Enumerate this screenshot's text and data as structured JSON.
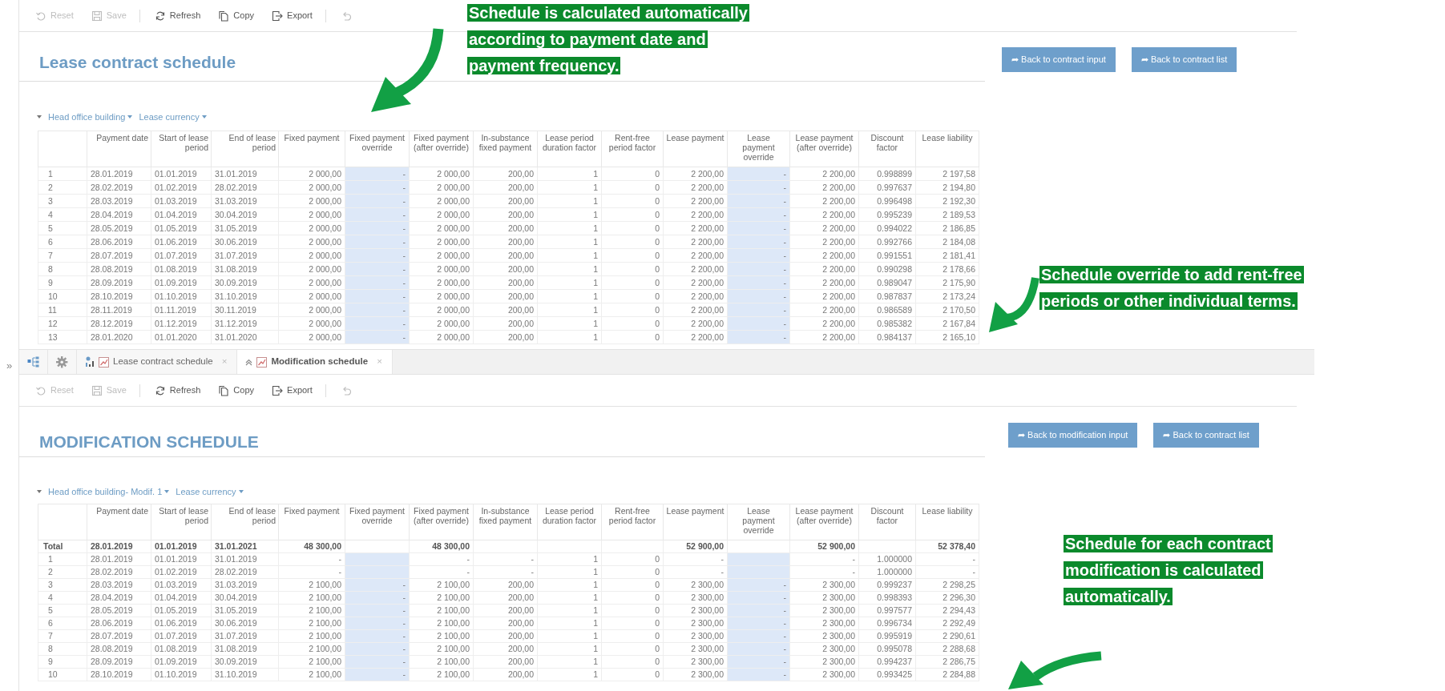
{
  "panes": [
    {
      "toolbar": {
        "groups": [
          [
            {
              "kind": "reset",
              "label": "Reset",
              "disabled": true
            },
            {
              "kind": "save",
              "label": "Save",
              "disabled": true
            }
          ],
          [
            {
              "kind": "refresh",
              "label": "Refresh",
              "disabled": false
            },
            {
              "kind": "copy",
              "label": "Copy",
              "disabled": false
            },
            {
              "kind": "export",
              "label": "Export",
              "disabled": false
            }
          ],
          [
            {
              "kind": "undo",
              "disabled": true
            }
          ]
        ]
      },
      "title": "Lease contract schedule",
      "buttons": [
        "➦ Back to contract input",
        "➦ Back to contract list"
      ],
      "filters": [
        {
          "label": "Head office building"
        },
        {
          "label": "Lease currency"
        }
      ],
      "table": {
        "columns": [
          {
            "kind": "index"
          },
          {
            "label": "Payment date",
            "kind": "date"
          },
          {
            "label": "Start of lease period",
            "kind": "date"
          },
          {
            "label": "End of lease period",
            "kind": "date"
          },
          {
            "label": "Fixed payment",
            "kind": "number"
          },
          {
            "label": "Fixed payment override",
            "kind": "override"
          },
          {
            "label": "Fixed payment (after override)",
            "kind": "number"
          },
          {
            "label": "In-substance fixed payment",
            "kind": "number"
          },
          {
            "label": "Lease period duration factor",
            "kind": "number"
          },
          {
            "label": "Rent-free period factor",
            "kind": "number"
          },
          {
            "label": "Lease payment",
            "kind": "number"
          },
          {
            "label": "Lease payment override",
            "kind": "override"
          },
          {
            "label": "Lease payment (after override)",
            "kind": "number"
          },
          {
            "label": "Discount factor",
            "kind": "number"
          },
          {
            "label": "Lease liability",
            "kind": "number"
          }
        ],
        "rows": [
          {
            "cells": [
              "1",
              "28.01.2019",
              "01.01.2019",
              "31.01.2019",
              "2 000,00",
              "-",
              "2 000,00",
              "200,00",
              "1",
              "0",
              "2 200,00",
              "-",
              "2 200,00",
              "0.998899",
              "2 197,58"
            ]
          },
          {
            "cells": [
              "2",
              "28.02.2019",
              "01.02.2019",
              "28.02.2019",
              "2 000,00",
              "-",
              "2 000,00",
              "200,00",
              "1",
              "0",
              "2 200,00",
              "-",
              "2 200,00",
              "0.997637",
              "2 194,80"
            ]
          },
          {
            "cells": [
              "3",
              "28.03.2019",
              "01.03.2019",
              "31.03.2019",
              "2 000,00",
              "-",
              "2 000,00",
              "200,00",
              "1",
              "0",
              "2 200,00",
              "-",
              "2 200,00",
              "0.996498",
              "2 192,30"
            ]
          },
          {
            "cells": [
              "4",
              "28.04.2019",
              "01.04.2019",
              "30.04.2019",
              "2 000,00",
              "-",
              "2 000,00",
              "200,00",
              "1",
              "0",
              "2 200,00",
              "-",
              "2 200,00",
              "0.995239",
              "2 189,53"
            ]
          },
          {
            "cells": [
              "5",
              "28.05.2019",
              "01.05.2019",
              "31.05.2019",
              "2 000,00",
              "-",
              "2 000,00",
              "200,00",
              "1",
              "0",
              "2 200,00",
              "-",
              "2 200,00",
              "0.994022",
              "2 186,85"
            ]
          },
          {
            "cells": [
              "6",
              "28.06.2019",
              "01.06.2019",
              "30.06.2019",
              "2 000,00",
              "-",
              "2 000,00",
              "200,00",
              "1",
              "0",
              "2 200,00",
              "-",
              "2 200,00",
              "0.992766",
              "2 184,08"
            ]
          },
          {
            "cells": [
              "7",
              "28.07.2019",
              "01.07.2019",
              "31.07.2019",
              "2 000,00",
              "-",
              "2 000,00",
              "200,00",
              "1",
              "0",
              "2 200,00",
              "-",
              "2 200,00",
              "0.991551",
              "2 181,41"
            ]
          },
          {
            "cells": [
              "8",
              "28.08.2019",
              "01.08.2019",
              "31.08.2019",
              "2 000,00",
              "-",
              "2 000,00",
              "200,00",
              "1",
              "0",
              "2 200,00",
              "-",
              "2 200,00",
              "0.990298",
              "2 178,66"
            ]
          },
          {
            "cells": [
              "9",
              "28.09.2019",
              "01.09.2019",
              "30.09.2019",
              "2 000,00",
              "-",
              "2 000,00",
              "200,00",
              "1",
              "0",
              "2 200,00",
              "-",
              "2 200,00",
              "0.989047",
              "2 175,90"
            ]
          },
          {
            "cells": [
              "10",
              "28.10.2019",
              "01.10.2019",
              "31.10.2019",
              "2 000,00",
              "-",
              "2 000,00",
              "200,00",
              "1",
              "0",
              "2 200,00",
              "-",
              "2 200,00",
              "0.987837",
              "2 173,24"
            ]
          },
          {
            "cells": [
              "11",
              "28.11.2019",
              "01.11.2019",
              "30.11.2019",
              "2 000,00",
              "-",
              "2 000,00",
              "200,00",
              "1",
              "0",
              "2 200,00",
              "-",
              "2 200,00",
              "0.986589",
              "2 170,50"
            ]
          },
          {
            "cells": [
              "12",
              "28.12.2019",
              "01.12.2019",
              "31.12.2019",
              "2 000,00",
              "-",
              "2 000,00",
              "200,00",
              "1",
              "0",
              "2 200,00",
              "-",
              "2 200,00",
              "0.985382",
              "2 167,84"
            ]
          },
          {
            "cells": [
              "13",
              "28.01.2020",
              "01.01.2020",
              "31.01.2020",
              "2 000,00",
              "-",
              "2 000,00",
              "200,00",
              "1",
              "0",
              "2 200,00",
              "-",
              "2 200,00",
              "0.984137",
              "2 165,10"
            ]
          }
        ]
      }
    },
    {
      "tab_bar": {
        "sidebar_toggle": "»",
        "tabs": [
          {
            "label": "Lease contract schedule",
            "close": "×",
            "selected": false
          },
          {
            "label": "Modification schedule",
            "close": "×",
            "selected": true
          }
        ]
      },
      "toolbar": {
        "groups": [
          [
            {
              "kind": "reset",
              "label": "Reset",
              "disabled": true
            },
            {
              "kind": "save",
              "label": "Save",
              "disabled": true
            }
          ],
          [
            {
              "kind": "refresh",
              "label": "Refresh",
              "disabled": false
            },
            {
              "kind": "copy",
              "label": "Copy",
              "disabled": false
            },
            {
              "kind": "export",
              "label": "Export",
              "disabled": false
            }
          ],
          [
            {
              "kind": "undo",
              "disabled": true
            }
          ]
        ]
      },
      "title": "MODIFICATION SCHEDULE",
      "buttons": [
        "➦ Back to modification input",
        "➦ Back to contract list"
      ],
      "filters": [
        {
          "label": "Head office building- Modif. 1"
        },
        {
          "label": "Lease currency"
        }
      ],
      "table": {
        "columns": [
          {
            "kind": "index"
          },
          {
            "label": "Payment date",
            "kind": "date"
          },
          {
            "label": "Start of lease period",
            "kind": "date"
          },
          {
            "label": "End of lease period",
            "kind": "date"
          },
          {
            "label": "Fixed payment",
            "kind": "number"
          },
          {
            "label": "Fixed payment override",
            "kind": "override"
          },
          {
            "label": "Fixed payment (after override)",
            "kind": "number"
          },
          {
            "label": "In-substance fixed payment",
            "kind": "number"
          },
          {
            "label": "Lease period duration factor",
            "kind": "number"
          },
          {
            "label": "Rent-free period factor",
            "kind": "number"
          },
          {
            "label": "Lease payment",
            "kind": "number"
          },
          {
            "label": "Lease payment override",
            "kind": "override"
          },
          {
            "label": "Lease payment (after override)",
            "kind": "number"
          },
          {
            "label": "Discount factor",
            "kind": "number"
          },
          {
            "label": "Lease liability",
            "kind": "number"
          }
        ],
        "rows": [
          {
            "kind": "total",
            "cells": [
              "Total",
              "28.01.2019",
              "01.01.2019",
              "31.01.2021",
              "48 300,00",
              null,
              "48 300,00",
              null,
              null,
              null,
              "52 900,00",
              null,
              "52 900,00",
              null,
              "52 378,40"
            ]
          },
          {
            "kind": "period",
            "cells": [
              "1",
              "28.01.2019",
              "01.01.2019",
              "31.01.2019",
              "-",
              null,
              "-",
              "-",
              "1",
              "0",
              "-",
              null,
              "-",
              "1.000000",
              "-"
            ]
          },
          {
            "kind": "period",
            "cells": [
              "2",
              "28.02.2019",
              "01.02.2019",
              "28.02.2019",
              "-",
              null,
              "-",
              "-",
              "1",
              "0",
              "-",
              null,
              "-",
              "1.000000",
              "-"
            ]
          },
          {
            "kind": "period",
            "cells": [
              "3",
              "28.03.2019",
              "01.03.2019",
              "31.03.2019",
              "2 100,00",
              "-",
              "2 100,00",
              "200,00",
              "1",
              "0",
              "2 300,00",
              "-",
              "2 300,00",
              "0.999237",
              "2 298,25"
            ]
          },
          {
            "kind": "period",
            "cells": [
              "4",
              "28.04.2019",
              "01.04.2019",
              "30.04.2019",
              "2 100,00",
              "-",
              "2 100,00",
              "200,00",
              "1",
              "0",
              "2 300,00",
              "-",
              "2 300,00",
              "0.998393",
              "2 296,30"
            ]
          },
          {
            "kind": "period",
            "cells": [
              "5",
              "28.05.2019",
              "01.05.2019",
              "31.05.2019",
              "2 100,00",
              "-",
              "2 100,00",
              "200,00",
              "1",
              "0",
              "2 300,00",
              "-",
              "2 300,00",
              "0.997577",
              "2 294,43"
            ]
          },
          {
            "kind": "period",
            "cells": [
              "6",
              "28.06.2019",
              "01.06.2019",
              "30.06.2019",
              "2 100,00",
              "-",
              "2 100,00",
              "200,00",
              "1",
              "0",
              "2 300,00",
              "-",
              "2 300,00",
              "0.996734",
              "2 292,49"
            ]
          },
          {
            "kind": "period",
            "cells": [
              "7",
              "28.07.2019",
              "01.07.2019",
              "31.07.2019",
              "2 100,00",
              "-",
              "2 100,00",
              "200,00",
              "1",
              "0",
              "2 300,00",
              "-",
              "2 300,00",
              "0.995919",
              "2 290,61"
            ]
          },
          {
            "kind": "period",
            "cells": [
              "8",
              "28.08.2019",
              "01.08.2019",
              "31.08.2019",
              "2 100,00",
              "-",
              "2 100,00",
              "200,00",
              "1",
              "0",
              "2 300,00",
              "-",
              "2 300,00",
              "0.995078",
              "2 288,68"
            ]
          },
          {
            "kind": "period",
            "cells": [
              "9",
              "28.09.2019",
              "01.09.2019",
              "30.09.2019",
              "2 100,00",
              "-",
              "2 100,00",
              "200,00",
              "1",
              "0",
              "2 300,00",
              "-",
              "2 300,00",
              "0.994237",
              "2 286,75"
            ]
          },
          {
            "kind": "period",
            "cells": [
              "10",
              "28.10.2019",
              "01.10.2019",
              "31.10.2019",
              "2 100,00",
              "-",
              "2 100,00",
              "200,00",
              "1",
              "0",
              "2 300,00",
              "-",
              "2 300,00",
              "0.993425",
              "2 284,88"
            ]
          }
        ]
      }
    }
  ],
  "callouts": [
    {
      "lines": [
        "Schedule is calculated automatically",
        "according to payment date and",
        "payment frequency."
      ]
    },
    {
      "lines": [
        "Schedule override to add rent-free",
        "periods or other individual terms."
      ]
    },
    {
      "lines": [
        "Schedule for each contract",
        "modification is calculated",
        "automatically."
      ]
    }
  ]
}
